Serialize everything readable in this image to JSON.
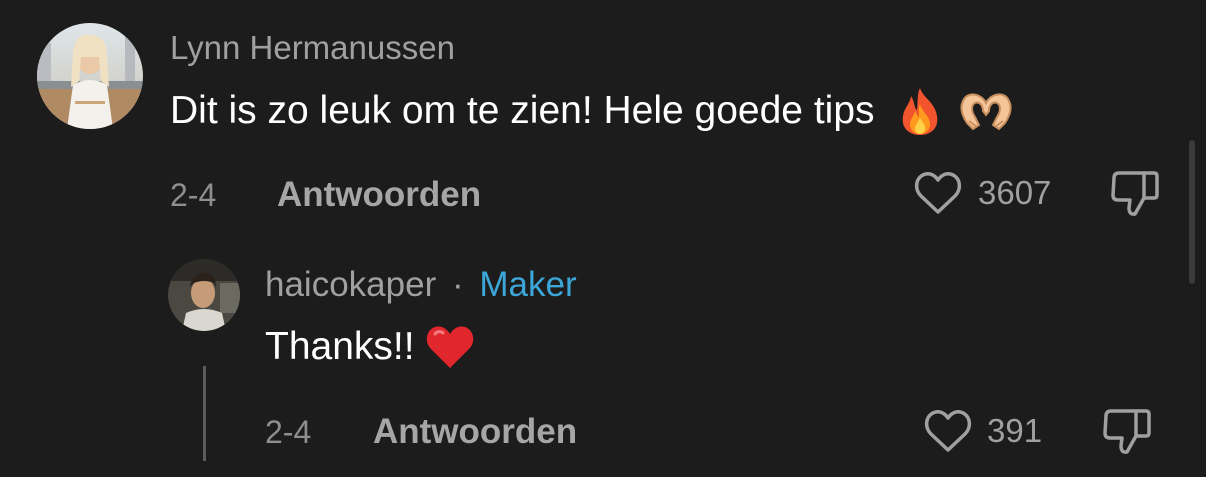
{
  "comments": [
    {
      "username": "Lynn Hermanussen",
      "text": "Dit is zo leuk om te zien! Hele goede tips",
      "emojis": [
        "fire-emoji",
        "heart-hands-emoji"
      ],
      "date": "2-4",
      "reply_label": "Antwoorden",
      "like_count": "3607"
    }
  ],
  "reply": {
    "username": "haicokaper",
    "separator": "·",
    "creator_badge": "Maker",
    "text": "Thanks!!",
    "emoji": "red-heart-emoji",
    "date": "2-4",
    "reply_label": "Antwoorden",
    "like_count": "391"
  },
  "colors": {
    "background": "#1c1c1c",
    "username": "#a0a0a0",
    "maker_badge": "#3da6d8",
    "text": "#ffffff"
  }
}
